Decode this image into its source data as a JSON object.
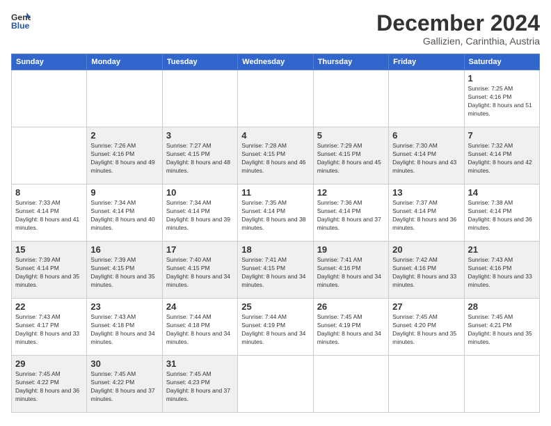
{
  "header": {
    "logo": {
      "line1": "General",
      "line2": "Blue"
    },
    "title": "December 2024",
    "subtitle": "Gallizien, Carinthia, Austria"
  },
  "calendar": {
    "days_of_week": [
      "Sunday",
      "Monday",
      "Tuesday",
      "Wednesday",
      "Thursday",
      "Friday",
      "Saturday"
    ],
    "weeks": [
      [
        null,
        null,
        null,
        null,
        null,
        null,
        {
          "day": 1,
          "sunrise": "7:25 AM",
          "sunset": "4:16 PM",
          "daylight": "8 hours and 51 minutes."
        }
      ],
      [
        {
          "day": 2,
          "sunrise": "7:26 AM",
          "sunset": "4:16 PM",
          "daylight": "8 hours and 49 minutes."
        },
        {
          "day": 3,
          "sunrise": "7:27 AM",
          "sunset": "4:15 PM",
          "daylight": "8 hours and 48 minutes."
        },
        {
          "day": 4,
          "sunrise": "7:28 AM",
          "sunset": "4:15 PM",
          "daylight": "8 hours and 46 minutes."
        },
        {
          "day": 5,
          "sunrise": "7:29 AM",
          "sunset": "4:15 PM",
          "daylight": "8 hours and 45 minutes."
        },
        {
          "day": 6,
          "sunrise": "7:30 AM",
          "sunset": "4:14 PM",
          "daylight": "8 hours and 43 minutes."
        },
        {
          "day": 7,
          "sunrise": "7:32 AM",
          "sunset": "4:14 PM",
          "daylight": "8 hours and 42 minutes."
        }
      ],
      [
        {
          "day": 8,
          "sunrise": "7:33 AM",
          "sunset": "4:14 PM",
          "daylight": "8 hours and 41 minutes."
        },
        {
          "day": 9,
          "sunrise": "7:34 AM",
          "sunset": "4:14 PM",
          "daylight": "8 hours and 40 minutes."
        },
        {
          "day": 10,
          "sunrise": "7:34 AM",
          "sunset": "4:14 PM",
          "daylight": "8 hours and 39 minutes."
        },
        {
          "day": 11,
          "sunrise": "7:35 AM",
          "sunset": "4:14 PM",
          "daylight": "8 hours and 38 minutes."
        },
        {
          "day": 12,
          "sunrise": "7:36 AM",
          "sunset": "4:14 PM",
          "daylight": "8 hours and 37 minutes."
        },
        {
          "day": 13,
          "sunrise": "7:37 AM",
          "sunset": "4:14 PM",
          "daylight": "8 hours and 36 minutes."
        },
        {
          "day": 14,
          "sunrise": "7:38 AM",
          "sunset": "4:14 PM",
          "daylight": "8 hours and 36 minutes."
        }
      ],
      [
        {
          "day": 15,
          "sunrise": "7:39 AM",
          "sunset": "4:14 PM",
          "daylight": "8 hours and 35 minutes."
        },
        {
          "day": 16,
          "sunrise": "7:39 AM",
          "sunset": "4:15 PM",
          "daylight": "8 hours and 35 minutes."
        },
        {
          "day": 17,
          "sunrise": "7:40 AM",
          "sunset": "4:15 PM",
          "daylight": "8 hours and 34 minutes."
        },
        {
          "day": 18,
          "sunrise": "7:41 AM",
          "sunset": "4:15 PM",
          "daylight": "8 hours and 34 minutes."
        },
        {
          "day": 19,
          "sunrise": "7:41 AM",
          "sunset": "4:16 PM",
          "daylight": "8 hours and 34 minutes."
        },
        {
          "day": 20,
          "sunrise": "7:42 AM",
          "sunset": "4:16 PM",
          "daylight": "8 hours and 33 minutes."
        },
        {
          "day": 21,
          "sunrise": "7:43 AM",
          "sunset": "4:16 PM",
          "daylight": "8 hours and 33 minutes."
        }
      ],
      [
        {
          "day": 22,
          "sunrise": "7:43 AM",
          "sunset": "4:17 PM",
          "daylight": "8 hours and 33 minutes."
        },
        {
          "day": 23,
          "sunrise": "7:43 AM",
          "sunset": "4:18 PM",
          "daylight": "8 hours and 34 minutes."
        },
        {
          "day": 24,
          "sunrise": "7:44 AM",
          "sunset": "4:18 PM",
          "daylight": "8 hours and 34 minutes."
        },
        {
          "day": 25,
          "sunrise": "7:44 AM",
          "sunset": "4:19 PM",
          "daylight": "8 hours and 34 minutes."
        },
        {
          "day": 26,
          "sunrise": "7:45 AM",
          "sunset": "4:19 PM",
          "daylight": "8 hours and 34 minutes."
        },
        {
          "day": 27,
          "sunrise": "7:45 AM",
          "sunset": "4:20 PM",
          "daylight": "8 hours and 35 minutes."
        },
        {
          "day": 28,
          "sunrise": "7:45 AM",
          "sunset": "4:21 PM",
          "daylight": "8 hours and 35 minutes."
        }
      ],
      [
        {
          "day": 29,
          "sunrise": "7:45 AM",
          "sunset": "4:22 PM",
          "daylight": "8 hours and 36 minutes."
        },
        {
          "day": 30,
          "sunrise": "7:45 AM",
          "sunset": "4:22 PM",
          "daylight": "8 hours and 37 minutes."
        },
        {
          "day": 31,
          "sunrise": "7:45 AM",
          "sunset": "4:23 PM",
          "daylight": "8 hours and 37 minutes."
        },
        null,
        null,
        null,
        null
      ]
    ]
  }
}
